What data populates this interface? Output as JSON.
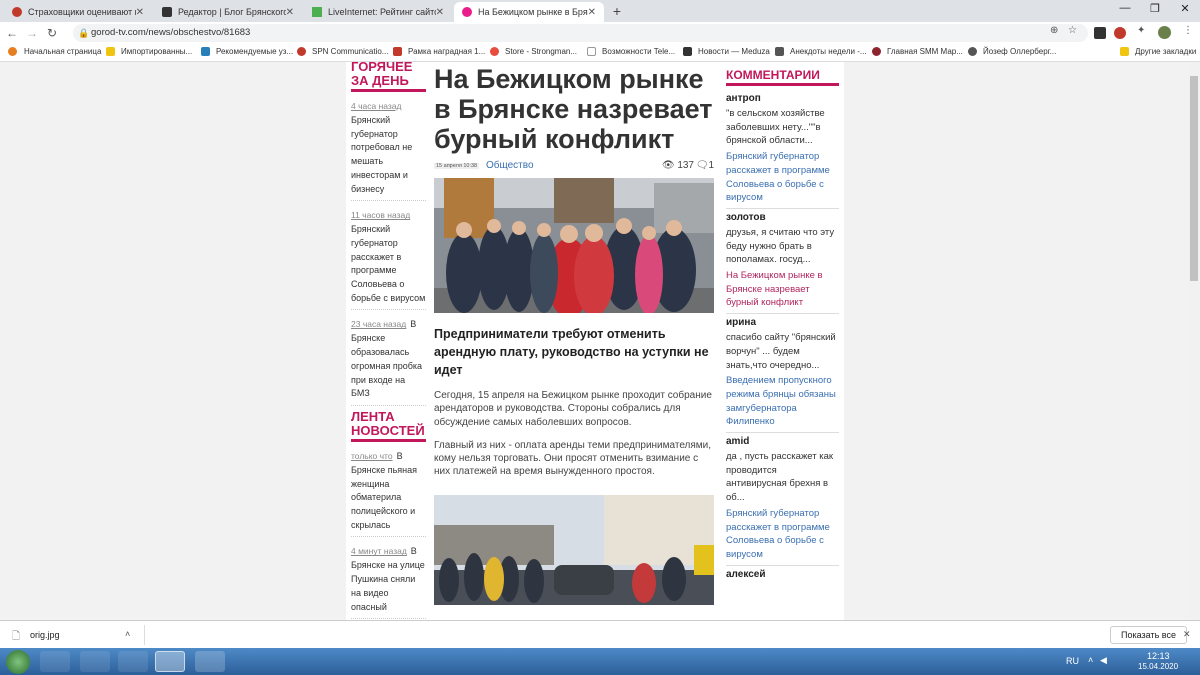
{
  "browser": {
    "tabs": [
      {
        "title": "Страховщики оценивают веро",
        "color": "#c0392b",
        "active": false
      },
      {
        "title": "Редактор | Блог Брянского Стр",
        "color": "#333333",
        "active": false
      },
      {
        "title": "LiveInternet: Рейтинг сайтов",
        "color": "#4caf50",
        "active": false
      },
      {
        "title": "На Бежицком рынке в Брянске",
        "color": "#e91e8c",
        "active": true
      }
    ],
    "url": "gorod-tv.com/news/obschestvo/81683",
    "bookmarks": [
      {
        "label": "Начальная страница",
        "color": "#e67e22"
      },
      {
        "label": "Импортированны...",
        "color": "#f1c40f"
      },
      {
        "label": "Рекомендуемые уз...",
        "color": "#2980b9"
      },
      {
        "label": "SPN Communicatio...",
        "color": "#c0392b"
      },
      {
        "label": "Рамка наградная 1...",
        "color": "#c0392b"
      },
      {
        "label": "Store - Strongman...",
        "color": "#e74c3c"
      },
      {
        "label": "Возможности Tele...",
        "color": "#333333"
      },
      {
        "label": "Новости — Meduza",
        "color": "#333333"
      },
      {
        "label": "Анекдоты недели -...",
        "color": "#555555"
      },
      {
        "label": "Главная SMM Мар...",
        "color": "#8e2430"
      },
      {
        "label": "Йозеф Оллерберг...",
        "color": "#555555"
      }
    ],
    "other_bookmarks": "Другие закладки"
  },
  "left": {
    "hot_title": "ГОРЯЧЕЕ ЗА ДЕНЬ",
    "hot": [
      {
        "time": "4 часа назад",
        "mark": "",
        "text": "Брянский губернатор потребовал не мешать инвесторам и бизнесу"
      },
      {
        "time": "11 часов назад",
        "mark": "",
        "text": "Брянский губернатор расскажет в программе Соловьева о борьбе с вирусом"
      },
      {
        "time": "23 часа назад",
        "mark": "В",
        "text": "Брянске образовалась огромная пробка при входе на БМЗ"
      }
    ],
    "feed_title": "ЛЕНТА НОВОСТЕЙ",
    "feed": [
      {
        "time": "только что",
        "mark": "В",
        "text": "Брянске пьяная женщина обматерила полицейского и скрылась"
      },
      {
        "time": "4 минут назад",
        "mark": "В",
        "text": "Брянске на улице Пушкина сняли на видео опасный"
      }
    ]
  },
  "article": {
    "title": "На Бежицком рынке в Брянске назревает бурный конфликт",
    "date": "15 апреля 10:38",
    "category": "Общество",
    "views": "137",
    "comments": "1",
    "subhead": "Предприниматели требуют отменить арендную плату, руководство на уступки не идет",
    "para1": "Сегодня, 15 апреля на Бежицком рынке проходит собрание арендаторов и руководства. Стороны собрались для обсуждение самых наболевших вопросов.",
    "para2": "Главный из них - оплата аренды теми предпринимателями, кому нельзя торговать. Они просят отменить взимание с них платежей на время вынужденного простоя."
  },
  "comments": {
    "title": "КОММЕНТАРИИ",
    "items": [
      {
        "user": "антроп",
        "text": "\"в сельском хозяйстве заболевших нету...\"\"в брянской области...",
        "link": "Брянский губернатор расскажет в программе Соловьева о борьбе с вирусом",
        "link_color": "#3a6fb0"
      },
      {
        "user": "золотов",
        "text": "друзья, я считаю что эту беду нужно брать в пополамах. госуд...",
        "link": "На Бежицком рынке в Брянске назревает бурный конфликт",
        "link_color": "#b0245e"
      },
      {
        "user": "ирина",
        "text": "спасибо сайту \"брянский ворчун\" ... будем знать,что очередно...",
        "link": "Введением пропускного режима брянцы обязаны замгубернатора Филипенко",
        "link_color": "#3a6fb0"
      },
      {
        "user": "amid",
        "text": "да , пусть расскажет как проводится антивирусная брехня в об...",
        "link": "Брянский губернатор расскажет в программе Соловьева о борьбе с вирусом",
        "link_color": "#3a6fb0"
      },
      {
        "user": "алексей",
        "text": "",
        "link": "",
        "link_color": "#3a6fb0"
      }
    ]
  },
  "download": {
    "file": "orig.jpg",
    "show_all": "Показать все"
  },
  "taskbar": {
    "lang": "RU",
    "time": "12:13",
    "date": "15.04.2020"
  }
}
